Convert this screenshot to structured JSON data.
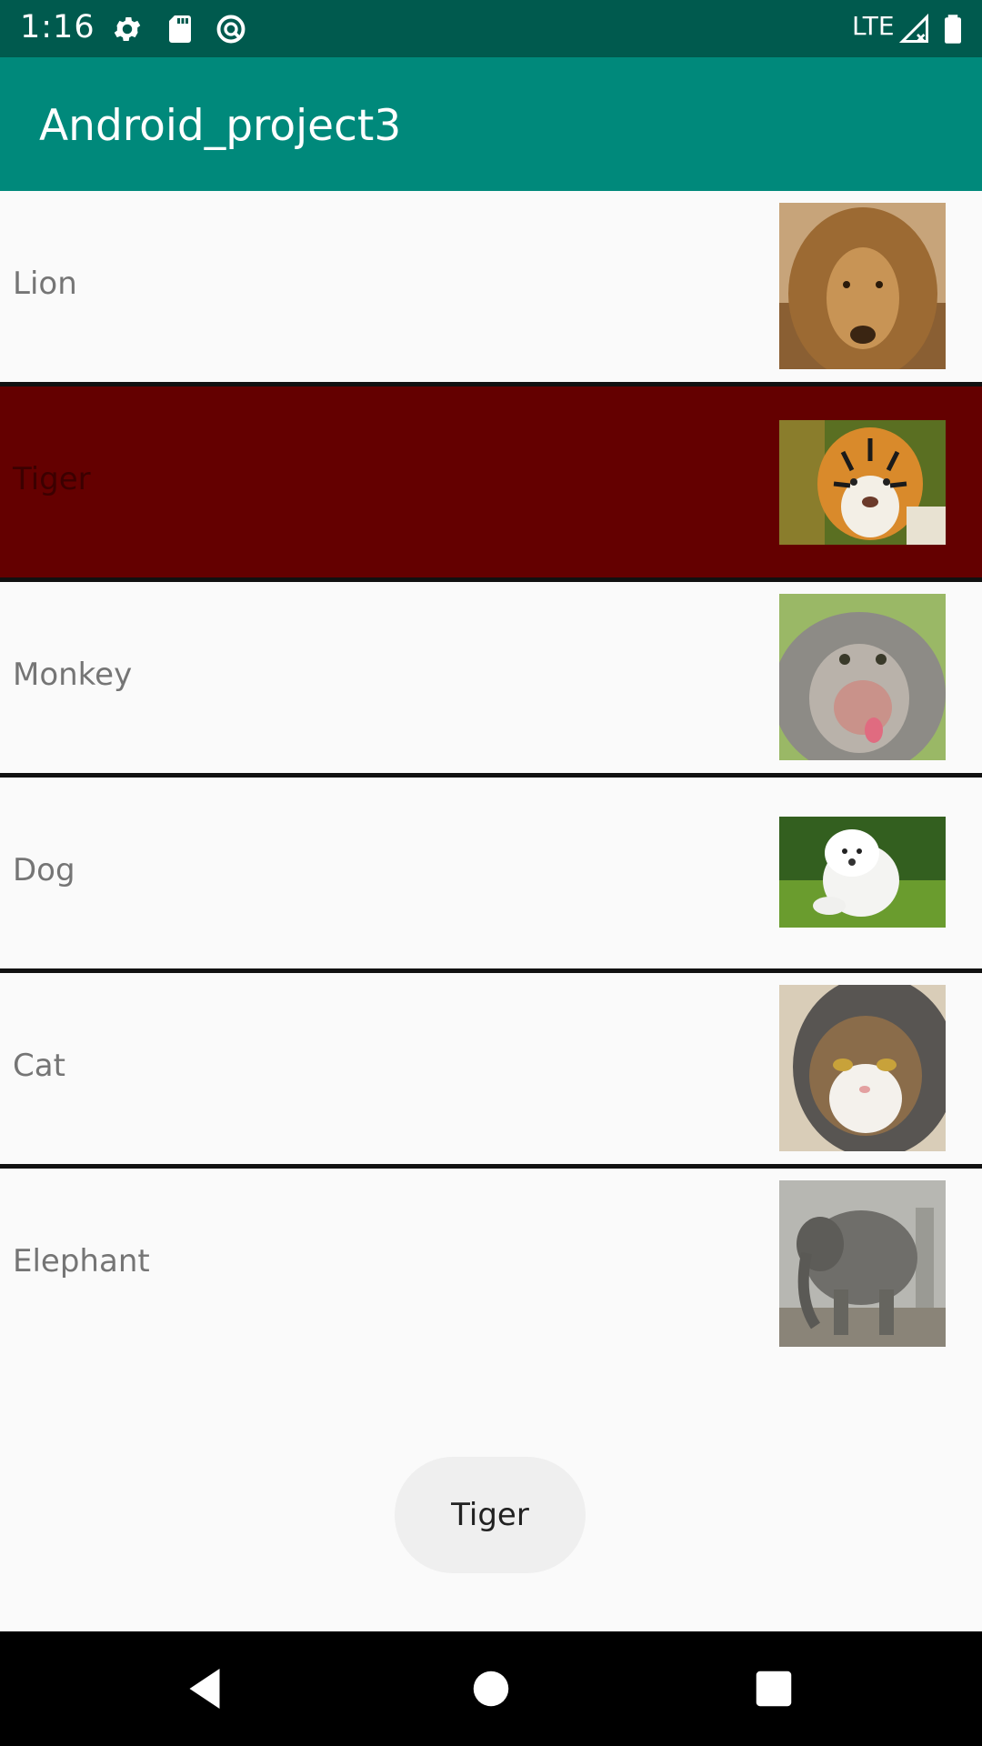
{
  "status_bar": {
    "time": "1:16",
    "network": "LTE",
    "icons": [
      "settings-icon",
      "sd-card-icon",
      "do-not-disturb-icon",
      "signal-icon",
      "battery-icon"
    ]
  },
  "app_bar": {
    "title": "Android_project3"
  },
  "list": {
    "items": [
      {
        "label": "Lion",
        "image": "lion-photo",
        "selected": false
      },
      {
        "label": "Tiger",
        "image": "tiger-photo",
        "selected": true
      },
      {
        "label": "Monkey",
        "image": "monkey-photo",
        "selected": false
      },
      {
        "label": "Dog",
        "image": "dog-photo",
        "selected": false
      },
      {
        "label": "Cat",
        "image": "cat-photo",
        "selected": false
      },
      {
        "label": "Elephant",
        "image": "elephant-photo",
        "selected": false
      }
    ]
  },
  "toast": {
    "text": "Tiger"
  },
  "nav_bar": {
    "icons": [
      "back-icon",
      "home-icon",
      "recents-icon"
    ]
  },
  "colors": {
    "status_bar": "#005a4e",
    "app_bar": "#00897b",
    "selected_row": "#640000",
    "background": "#fafafa"
  }
}
